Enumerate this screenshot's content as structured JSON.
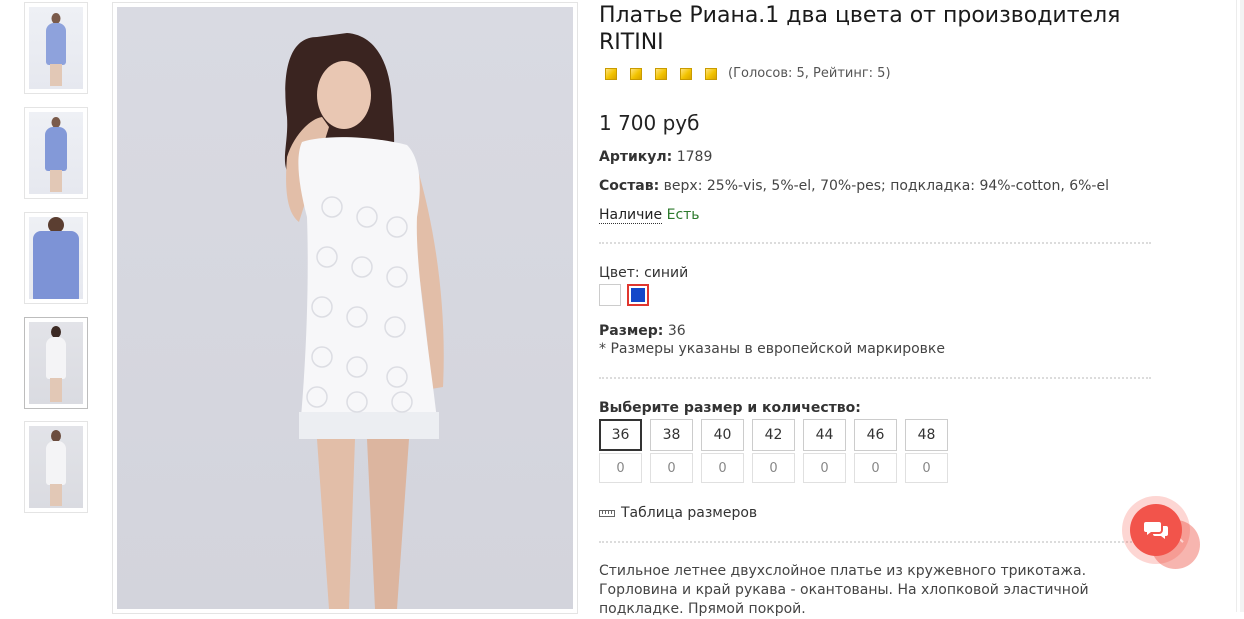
{
  "thumbnails": [
    {
      "name": "thumb-1",
      "variant": "blue",
      "active": false
    },
    {
      "name": "thumb-2",
      "variant": "blue",
      "active": false
    },
    {
      "name": "thumb-3",
      "variant": "blue",
      "active": false
    },
    {
      "name": "thumb-4",
      "variant": "white",
      "active": true
    },
    {
      "name": "thumb-5",
      "variant": "white",
      "active": false
    }
  ],
  "product": {
    "title": "Платье Риана.1 два цвета от производителя RITINI",
    "rating": {
      "stars": 5,
      "text": "(Голосов: 5, Рейтинг: 5)"
    },
    "price": "1 700 руб",
    "article_label": "Артикул:",
    "article_value": "1789",
    "composition_label": "Состав:",
    "composition_value": "верх: 25%-vis, 5%-el, 70%-pes; подкладка: 94%-cotton, 6%-el",
    "availability_label": "Наличие",
    "availability_value": "Есть",
    "color_label": "Цвет:",
    "color_value": "синий",
    "swatches": [
      {
        "name": "white",
        "color": "#ffffff",
        "selected": false
      },
      {
        "name": "blue",
        "color": "#1447c9",
        "selected": true
      }
    ],
    "size_label": "Размер:",
    "size_value": "36",
    "size_note": "* Размеры указаны в европейской маркировке",
    "choose_label": "Выберите размер и количество:",
    "sizes": [
      {
        "size": "36",
        "qty": "0",
        "selected": true
      },
      {
        "size": "38",
        "qty": "0",
        "selected": false
      },
      {
        "size": "40",
        "qty": "0",
        "selected": false
      },
      {
        "size": "42",
        "qty": "0",
        "selected": false
      },
      {
        "size": "44",
        "qty": "0",
        "selected": false
      },
      {
        "size": "46",
        "qty": "0",
        "selected": false
      },
      {
        "size": "48",
        "qty": "0",
        "selected": false
      }
    ],
    "size_table_link": "Таблица размеров",
    "description": "Стильное летнее двухслойное платье из кружевного трикотажа. Горловина и край рукава - окантованы. На хлопковой эластичной подкладке. Прямой покрой."
  },
  "colors": {
    "accent": "#f2544b",
    "available": "#2d7a2d",
    "star": "#f2c300"
  },
  "icons": {
    "chat": "chat-bubbles-icon",
    "scroll_top": "chevron-up-icon",
    "size_table": "ruler-icon"
  }
}
